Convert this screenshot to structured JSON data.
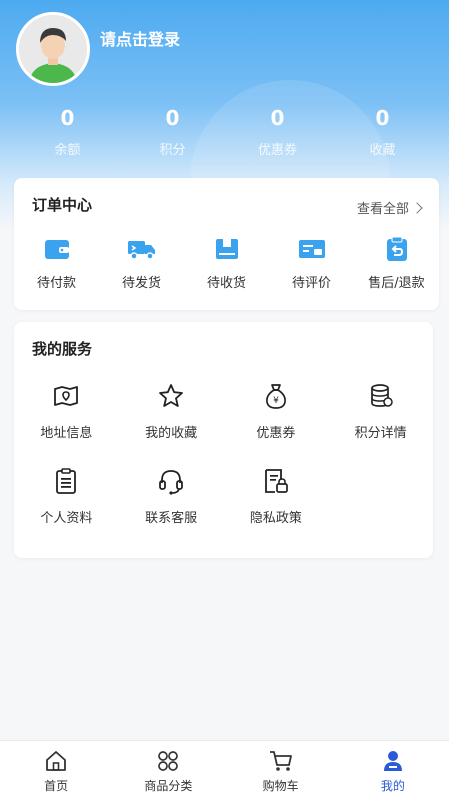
{
  "profile": {
    "login_prompt": "请点击登录"
  },
  "stats": [
    {
      "value": "0",
      "label": "余额"
    },
    {
      "value": "0",
      "label": "积分"
    },
    {
      "value": "0",
      "label": "优惠券"
    },
    {
      "value": "0",
      "label": "收藏"
    }
  ],
  "orders": {
    "title": "订单中心",
    "view_all": "查看全部",
    "items": [
      {
        "label": "待付款",
        "icon": "wallet-icon"
      },
      {
        "label": "待发货",
        "icon": "truck-icon"
      },
      {
        "label": "待收货",
        "icon": "package-icon"
      },
      {
        "label": "待评价",
        "icon": "review-icon"
      },
      {
        "label": "售后/退款",
        "icon": "refund-icon"
      }
    ]
  },
  "services": {
    "title": "我的服务",
    "items": [
      {
        "label": "地址信息",
        "icon": "map-icon"
      },
      {
        "label": "我的收藏",
        "icon": "star-icon"
      },
      {
        "label": "优惠券",
        "icon": "money-bag-icon"
      },
      {
        "label": "积分详情",
        "icon": "coins-icon"
      },
      {
        "label": "个人资料",
        "icon": "clipboard-icon"
      },
      {
        "label": "联系客服",
        "icon": "headset-icon"
      },
      {
        "label": "隐私政策",
        "icon": "privacy-doc-icon"
      }
    ]
  },
  "tabbar": {
    "items": [
      {
        "label": "首页",
        "icon": "home-icon"
      },
      {
        "label": "商品分类",
        "icon": "grid-icon"
      },
      {
        "label": "购物车",
        "icon": "cart-icon"
      },
      {
        "label": "我的",
        "icon": "user-icon"
      }
    ],
    "active_index": 3
  },
  "colors": {
    "accent": "#4daaf0",
    "tab_active": "#2a5bd7",
    "icon_blue": "#3ba2ee"
  }
}
